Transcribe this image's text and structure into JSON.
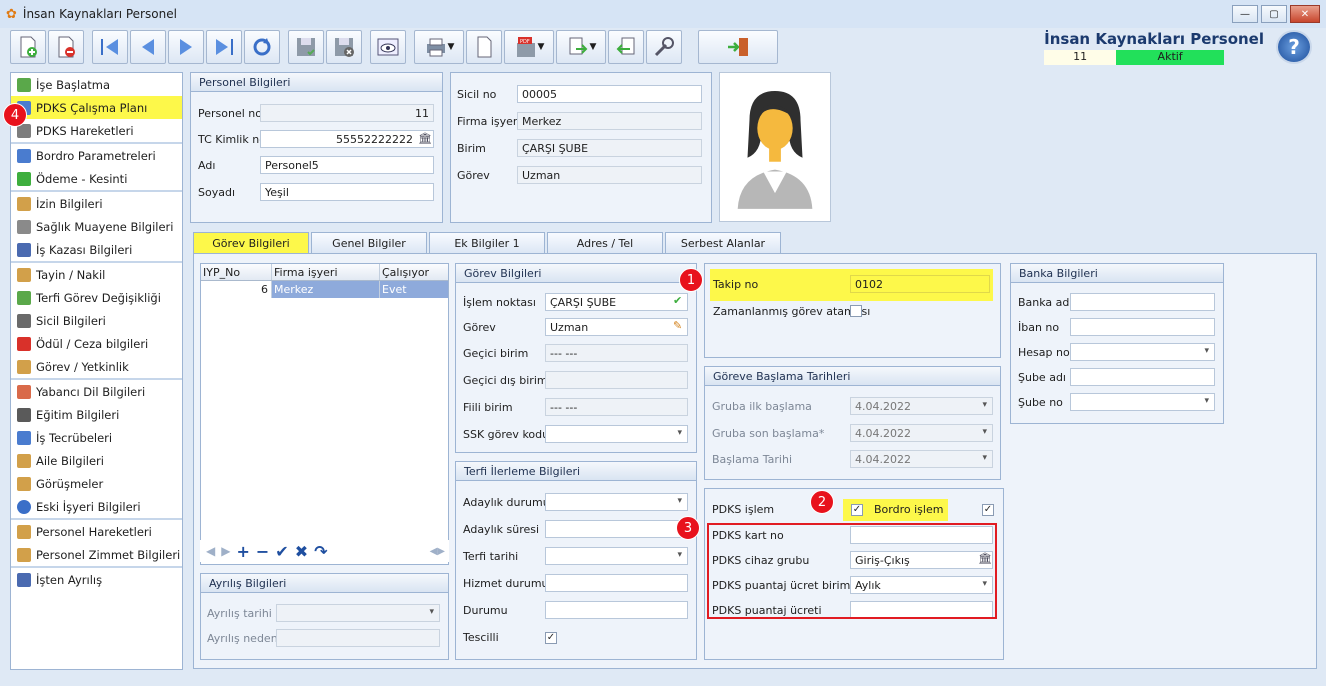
{
  "window": {
    "title": "İnsan Kaynakları Personel",
    "min": "—",
    "max": "▢",
    "close": "✕"
  },
  "header": {
    "title": "İnsan Kaynakları Personel",
    "record_id": "11",
    "status": "Aktif"
  },
  "help_label": "?",
  "toolbar": [
    "new-record",
    "delete-record",
    "first",
    "previous",
    "next",
    "last",
    "refresh",
    "save",
    "cancel",
    "preview",
    "print",
    "document",
    "pdf",
    "export",
    "import",
    "tools",
    "exit"
  ],
  "sidebar": {
    "groups": [
      [
        {
          "label": "İşe Başlatma",
          "icon": "flag-icon"
        },
        {
          "label": "PDKS Çalışma Planı",
          "icon": "calendar-icon"
        },
        {
          "label": "PDKS Hareketleri",
          "icon": "clock-icon"
        }
      ],
      [
        {
          "label": "Bordro Parametreleri",
          "icon": "table-icon"
        },
        {
          "label": "Ödeme - Kesinti",
          "icon": "money-icon"
        }
      ],
      [
        {
          "label": "İzin Bilgileri",
          "icon": "person-icon"
        },
        {
          "label": "Sağlık Muayene Bilgileri",
          "icon": "health-icon"
        },
        {
          "label": "İş Kazası Bilgileri",
          "icon": "accident-icon"
        }
      ],
      [
        {
          "label": "Tayin / Nakil",
          "icon": "person-icon"
        },
        {
          "label": "Terfi Görev Değişikliği",
          "icon": "chart-icon"
        },
        {
          "label": "Sicil Bilgileri",
          "icon": "pencil-icon"
        },
        {
          "label": "Ödül / Ceza bilgileri",
          "icon": "award-icon"
        },
        {
          "label": "Görev / Yetkinlik",
          "icon": "person-icon"
        }
      ],
      [
        {
          "label": "Yabancı Dil Bilgileri",
          "icon": "language-icon"
        },
        {
          "label": "Eğitim Bilgileri",
          "icon": "document-icon"
        },
        {
          "label": "İş Tecrübeleri",
          "icon": "document-icon"
        },
        {
          "label": "Aile Bilgileri",
          "icon": "family-icon"
        },
        {
          "label": "Görüşmeler",
          "icon": "meeting-icon"
        },
        {
          "label": "Eski İşyeri Bilgileri",
          "icon": "info-icon"
        }
      ],
      [
        {
          "label": "Personel Hareketleri",
          "icon": "person-icon"
        },
        {
          "label": "Personel Zimmet Bilgileri",
          "icon": "person-icon"
        }
      ],
      [
        {
          "label": "İşten Ayrılış",
          "icon": "exit-icon"
        }
      ]
    ]
  },
  "personel": {
    "title": "Personel Bilgileri",
    "personel_no_label": "Personel no",
    "personel_no": "11",
    "tc_label": "TC Kimlik no",
    "tc": "55552222222",
    "adi_label": "Adı",
    "adi": "Personel5",
    "soyadi_label": "Soyadı",
    "soyadi": "Yeşil"
  },
  "sicil": {
    "sicil_label": "Sicil no",
    "sicil": "00005",
    "firma_label": "Firma işyeri",
    "firma": "Merkez",
    "birim_label": "Birim",
    "birim": "ÇARŞI ŞUBE",
    "gorev_label": "Görev",
    "gorev": "Uzman"
  },
  "tabs": [
    "Görev Bilgileri",
    "Genel Bilgiler",
    "Ek Bilgiler 1",
    "Adres / Tel",
    "Serbest Alanlar"
  ],
  "grid": {
    "columns": [
      "IYP_No",
      "Firma işyeri",
      "Çalışıyor"
    ],
    "rows": [
      [
        "6",
        "Merkez",
        "Evet"
      ]
    ]
  },
  "gorev": {
    "title": "Görev Bilgileri",
    "islem_label": "İşlem noktası",
    "islem": "ÇARŞI ŞUBE",
    "gorev_label": "Görev",
    "gorev": "Uzman",
    "gecici_label": "Geçici birim",
    "gecici": "--- ---",
    "gecici_dis_label": "Geçici dış birim",
    "gecici_dis": "",
    "fiili_label": "Fiili birim",
    "fiili": "--- ---",
    "ssk_label": "SSK görev kodu",
    "ssk": ""
  },
  "terfi": {
    "title": "Terfi İlerleme Bilgileri",
    "adaylik_durumu": "Adaylık durumu",
    "adaylik_suresi": "Adaylık süresi",
    "terfi_tarihi": "Terfi tarihi",
    "hizmet_durumu": "Hizmet durumu",
    "durumu": "Durumu",
    "tescilli": "Tescilli"
  },
  "ayrilis": {
    "title": "Ayrılış Bilgileri",
    "tarih_label": "Ayrılış tarihi",
    "neden_label": "Ayrılış nedeni"
  },
  "takip": {
    "label": "Takip no",
    "value": "0102",
    "zamanlanmis": "Zamanlanmış görev ataması"
  },
  "baslama": {
    "title": "Göreve Başlama Tarihleri",
    "ilk_label": "Gruba ilk başlama",
    "ilk": "4.04.2022",
    "son_label": "Gruba son başlama*",
    "son": "4.04.2022",
    "bas_label": "Başlama Tarihi",
    "bas": "4.04.2022"
  },
  "pdks": {
    "islem_label": "PDKS işlem",
    "bordro_label": "Bordro işlem",
    "kart_label": "PDKS kart no",
    "kart": "",
    "cihaz_label": "PDKS cihaz grubu",
    "cihaz": "Giriş-Çıkış",
    "birim_label": "PDKS puantaj ücret birimi",
    "birim": "Aylık",
    "ucret_label": "PDKS puantaj ücreti",
    "ucret": ""
  },
  "banka": {
    "title": "Banka Bilgileri",
    "banka_adi": "Banka adı",
    "iban": "İban no",
    "hesap": "Hesap no",
    "sube_adi": "Şube adı",
    "sube_no": "Şube no"
  },
  "badges": [
    "1",
    "2",
    "3",
    "4"
  ]
}
